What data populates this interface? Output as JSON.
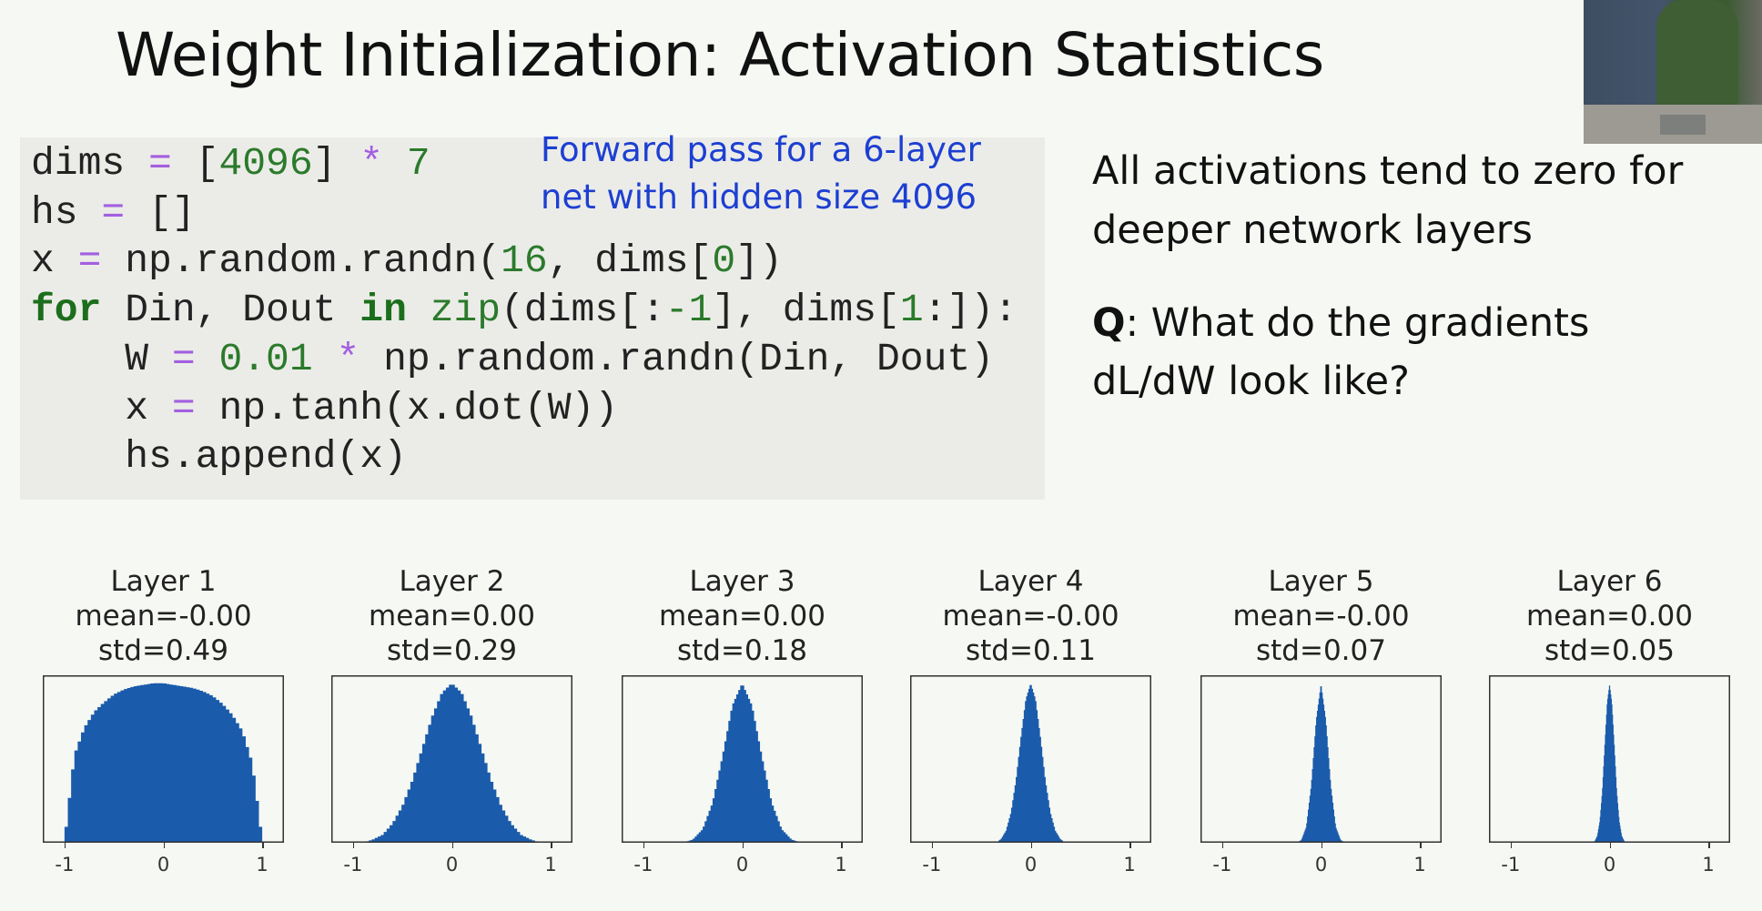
{
  "slide": {
    "title": "Weight Initialization: Activation Statistics"
  },
  "code": {
    "lines": [
      [
        {
          "t": "dims ",
          "c": ""
        },
        {
          "t": "=",
          "c": "op"
        },
        {
          "t": " [",
          "c": ""
        },
        {
          "t": "4096",
          "c": "num"
        },
        {
          "t": "] ",
          "c": ""
        },
        {
          "t": "*",
          "c": "op"
        },
        {
          "t": " ",
          "c": ""
        },
        {
          "t": "7",
          "c": "num"
        }
      ],
      [
        {
          "t": "hs ",
          "c": ""
        },
        {
          "t": "=",
          "c": "op"
        },
        {
          "t": " []",
          "c": ""
        }
      ],
      [
        {
          "t": "x ",
          "c": ""
        },
        {
          "t": "=",
          "c": "op"
        },
        {
          "t": " np.random.randn(",
          "c": ""
        },
        {
          "t": "16",
          "c": "num"
        },
        {
          "t": ", dims[",
          "c": ""
        },
        {
          "t": "0",
          "c": "num"
        },
        {
          "t": "])",
          "c": ""
        }
      ],
      [
        {
          "t": "for",
          "c": "kw"
        },
        {
          "t": " Din, Dout ",
          "c": ""
        },
        {
          "t": "in",
          "c": "kw"
        },
        {
          "t": " ",
          "c": ""
        },
        {
          "t": "zip",
          "c": "fn"
        },
        {
          "t": "(dims[:",
          "c": ""
        },
        {
          "t": "-1",
          "c": "num"
        },
        {
          "t": "], dims[",
          "c": ""
        },
        {
          "t": "1",
          "c": "num"
        },
        {
          "t": ":]):",
          "c": ""
        }
      ],
      [
        {
          "t": "    W ",
          "c": ""
        },
        {
          "t": "=",
          "c": "op"
        },
        {
          "t": " ",
          "c": ""
        },
        {
          "t": "0.01",
          "c": "num"
        },
        {
          "t": " ",
          "c": ""
        },
        {
          "t": "*",
          "c": "op"
        },
        {
          "t": " np.random.randn(Din, Dout)",
          "c": ""
        }
      ],
      [
        {
          "t": "    x ",
          "c": ""
        },
        {
          "t": "=",
          "c": "op"
        },
        {
          "t": " np.tanh(x.dot(W))",
          "c": ""
        }
      ],
      [
        {
          "t": "    hs.append(x)",
          "c": ""
        }
      ]
    ],
    "comment_lines": [
      "Forward pass for a 6-layer",
      "net with hidden size 4096"
    ]
  },
  "side_text": {
    "line1": "All activations tend to zero for",
    "line2": "deeper network layers",
    "q_label": "Q",
    "q_line1": ": What do the gradients",
    "q_line2": "dL/dW look like?"
  },
  "colors": {
    "bar": "#1a5bab",
    "background": "#f6f8f3",
    "code_background": "#ebece8",
    "comment": "#1d3fd1"
  },
  "chart_data": [
    {
      "type": "histogram",
      "title": "Layer 1",
      "mean_label": "mean=-0.00",
      "std_label": "std=0.49",
      "xlim": [
        -1.22,
        1.22
      ],
      "xticks": [
        "-1",
        "0",
        "1"
      ],
      "grid": false,
      "x": [
        -1.0,
        -0.98,
        -0.9,
        -0.8,
        -0.7,
        -0.6,
        -0.5,
        -0.4,
        -0.3,
        -0.2,
        -0.1,
        0,
        0.1,
        0.2,
        0.3,
        0.4,
        0.5,
        0.6,
        0.7,
        0.8,
        0.9,
        0.98,
        1.0
      ],
      "density": [
        0,
        0.12,
        0.55,
        0.72,
        0.82,
        0.88,
        0.93,
        0.96,
        0.98,
        0.99,
        1,
        1,
        0.99,
        0.98,
        0.97,
        0.95,
        0.92,
        0.87,
        0.8,
        0.7,
        0.5,
        0.12,
        0
      ]
    },
    {
      "type": "histogram",
      "title": "Layer 2",
      "mean_label": "mean=0.00",
      "std_label": "std=0.29",
      "xlim": [
        -1.22,
        1.22
      ],
      "xticks": [
        "-1",
        "0",
        "1"
      ],
      "grid": false,
      "x": [
        -0.9,
        -0.8,
        -0.7,
        -0.6,
        -0.5,
        -0.4,
        -0.3,
        -0.2,
        -0.1,
        0,
        0.1,
        0.2,
        0.3,
        0.4,
        0.5,
        0.6,
        0.7,
        0.8,
        0.9
      ],
      "density": [
        0,
        0.02,
        0.05,
        0.12,
        0.23,
        0.39,
        0.59,
        0.79,
        0.94,
        1,
        0.94,
        0.79,
        0.59,
        0.39,
        0.23,
        0.12,
        0.05,
        0.02,
        0
      ]
    },
    {
      "type": "histogram",
      "title": "Layer 3",
      "mean_label": "mean=0.00",
      "std_label": "std=0.18",
      "xlim": [
        -1.22,
        1.22
      ],
      "xticks": [
        "-1",
        "0",
        "1"
      ],
      "grid": false,
      "x": [
        -0.6,
        -0.5,
        -0.4,
        -0.3,
        -0.2,
        -0.1,
        0,
        0.1,
        0.2,
        0.3,
        0.4,
        0.5,
        0.6
      ],
      "density": [
        0,
        0.02,
        0.085,
        0.25,
        0.54,
        0.86,
        1,
        0.86,
        0.54,
        0.25,
        0.085,
        0.02,
        0
      ]
    },
    {
      "type": "histogram",
      "title": "Layer 4",
      "mean_label": "mean=-0.00",
      "std_label": "std=0.11",
      "xlim": [
        -1.22,
        1.22
      ],
      "xticks": [
        "-1",
        "0",
        "1"
      ],
      "grid": false,
      "x": [
        -0.35,
        -0.3,
        -0.25,
        -0.2,
        -0.15,
        -0.1,
        -0.05,
        0,
        0.05,
        0.1,
        0.15,
        0.2,
        0.25,
        0.3,
        0.35
      ],
      "density": [
        0,
        0.024,
        0.076,
        0.19,
        0.39,
        0.66,
        0.9,
        1,
        0.9,
        0.66,
        0.39,
        0.19,
        0.076,
        0.024,
        0
      ]
    },
    {
      "type": "histogram",
      "title": "Layer 5",
      "mean_label": "mean=-0.00",
      "std_label": "std=0.07",
      "xlim": [
        -1.22,
        1.22
      ],
      "xticks": [
        "-1",
        "0",
        "1"
      ],
      "grid": false,
      "x": [
        -0.25,
        -0.2,
        -0.15,
        -0.1,
        -0.05,
        0,
        0.05,
        0.1,
        0.15,
        0.2,
        0.25
      ],
      "density": [
        0,
        0.017,
        0.1,
        0.36,
        0.77,
        1,
        0.77,
        0.36,
        0.1,
        0.017,
        0
      ]
    },
    {
      "type": "histogram",
      "title": "Layer 6",
      "mean_label": "mean=0.00",
      "std_label": "std=0.05",
      "xlim": [
        -1.22,
        1.22
      ],
      "xticks": [
        "-1",
        "0",
        "1"
      ],
      "grid": false,
      "x": [
        -0.175,
        -0.15,
        -0.125,
        -0.1,
        -0.075,
        -0.05,
        -0.025,
        0,
        0.025,
        0.05,
        0.075,
        0.1,
        0.125,
        0.15,
        0.175
      ],
      "density": [
        0,
        0.011,
        0.044,
        0.135,
        0.32,
        0.61,
        0.88,
        1,
        0.88,
        0.61,
        0.32,
        0.135,
        0.044,
        0.011,
        0
      ]
    }
  ]
}
